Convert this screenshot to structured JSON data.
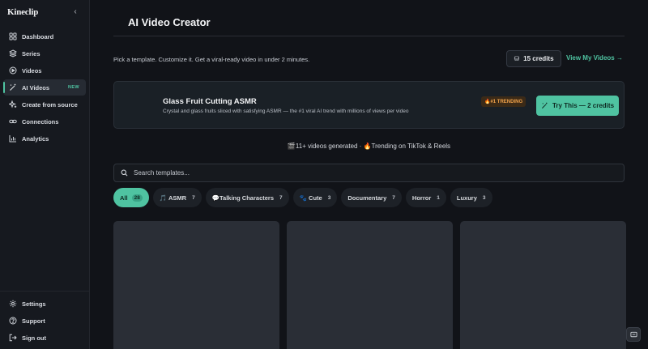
{
  "app": {
    "brand": "Kineclip"
  },
  "sidebar": {
    "items": [
      {
        "label": "Dashboard",
        "icon": "grid-icon"
      },
      {
        "label": "Series",
        "icon": "layers-icon"
      },
      {
        "label": "Videos",
        "icon": "play-circle-icon"
      },
      {
        "label": "AI Videos",
        "icon": "magic-wand-icon",
        "badge": "NEW",
        "active": true
      },
      {
        "label": "Create from source",
        "icon": "sparkle-icon"
      },
      {
        "label": "Connections",
        "icon": "link-icon"
      },
      {
        "label": "Analytics",
        "icon": "bar-chart-icon"
      }
    ],
    "bottom": [
      {
        "label": "Settings",
        "icon": "gear-icon"
      },
      {
        "label": "Support",
        "icon": "help-circle-icon"
      },
      {
        "label": "Sign out",
        "icon": "sign-out-icon"
      }
    ]
  },
  "main": {
    "title": "AI Video Creator",
    "subtitle": "Pick a template. Customize it. Get a viral-ready video in under 2 minutes.",
    "credits_label": "15 credits",
    "view_link": "View My Videos →",
    "featured": {
      "title": "Glass Fruit Cutting ASMR",
      "description": "Crystal and glass fruits sliced with satisfying ASMR — the #1 viral AI trend with millions of views per video",
      "badge": "🔥#1 TRENDING",
      "cta": "Try This — 2 credits"
    },
    "stats": "🎬11+ videos generated · 🔥Trending on TikTok & Reels",
    "search": {
      "placeholder": "Search templates..."
    },
    "filters": [
      {
        "label": "All",
        "count": "28",
        "active": true
      },
      {
        "label": "🎵 ASMR",
        "count": "7"
      },
      {
        "label": "💬Talking Characters",
        "count": "7"
      },
      {
        "label": "🐾 Cute",
        "count": "3"
      },
      {
        "label": "Documentary",
        "count": "7"
      },
      {
        "label": "Horror",
        "count": "1"
      },
      {
        "label": "Luxury",
        "count": "3"
      }
    ]
  },
  "colors": {
    "accent": "#4fc3a1",
    "background": "#111318",
    "sidebar": "#16191f",
    "trending": "#f0a24a"
  }
}
